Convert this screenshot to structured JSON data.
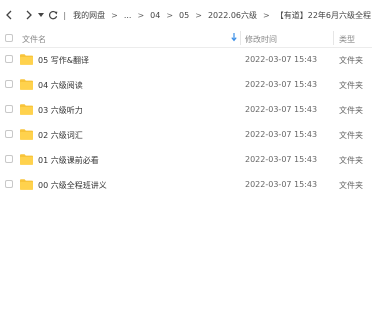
{
  "breadcrumb": [
    "我的网盘",
    "...",
    "04",
    "05",
    "2022.06六级",
    "【有道】22年6月六级全程"
  ],
  "header": {
    "name": "文件名",
    "modified": "修改时间",
    "type": "类型"
  },
  "rows": [
    {
      "name": "05 写作&翻译",
      "modified": "2022-03-07 15:43",
      "type": "文件夹"
    },
    {
      "name": "04 六级阅读",
      "modified": "2022-03-07 15:43",
      "type": "文件夹"
    },
    {
      "name": "03 六级听力",
      "modified": "2022-03-07 15:43",
      "type": "文件夹"
    },
    {
      "name": "02 六级词汇",
      "modified": "2022-03-07 15:43",
      "type": "文件夹"
    },
    {
      "name": "01 六级课前必看",
      "modified": "2022-03-07 15:43",
      "type": "文件夹"
    },
    {
      "name": "00 六级全程班讲义",
      "modified": "2022-03-07 15:43",
      "type": "文件夹"
    }
  ],
  "icons": {
    "back": "chevron-left-icon",
    "forward": "chevron-right-icon",
    "history": "caret-down-icon",
    "refresh": "refresh-icon",
    "folder": "folder-icon",
    "sort": "sort-down-arrow-icon"
  },
  "colors": {
    "folder": "#f8c43a",
    "sort_arrow": "#3a8ee6"
  }
}
